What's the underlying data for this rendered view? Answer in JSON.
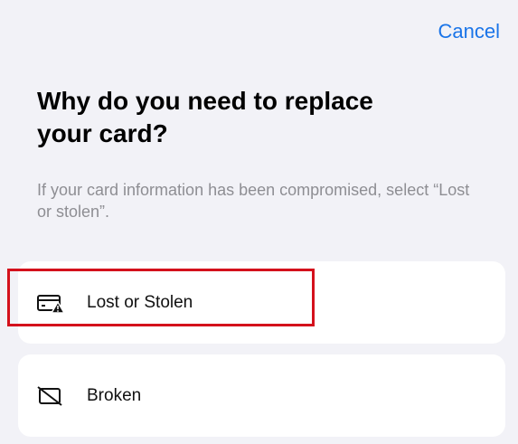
{
  "header": {
    "cancel_label": "Cancel"
  },
  "main": {
    "title": "Why do you need to replace your card?",
    "subtitle": "If your card information has been compromised, select “Lost or stolen”."
  },
  "options": [
    {
      "label": "Lost or Stolen",
      "icon": "card-warning-icon"
    },
    {
      "label": "Broken",
      "icon": "broken-card-icon"
    }
  ],
  "colors": {
    "accent": "#1a74e8",
    "highlight": "#d4111c",
    "background": "#f2f2f7"
  }
}
